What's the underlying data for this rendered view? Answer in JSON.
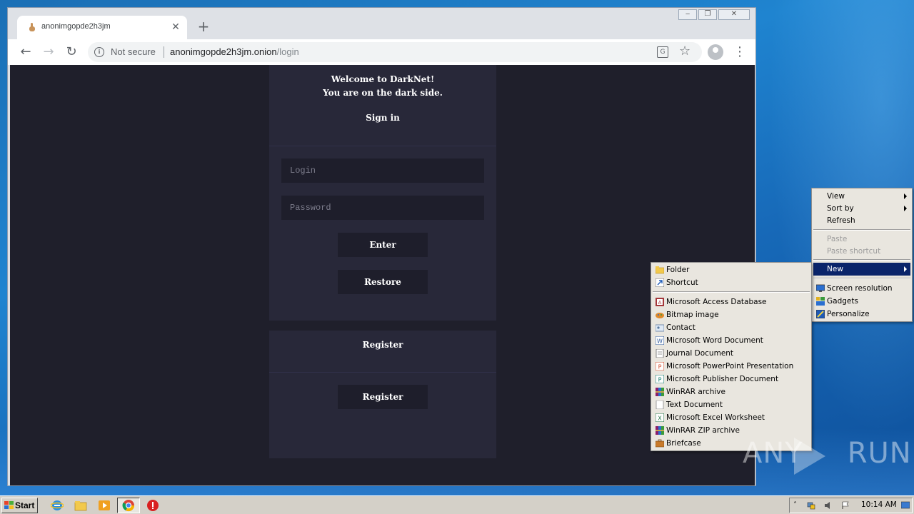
{
  "browser": {
    "tab_title": "anonimgopde2h3jm",
    "tab_close": "✕",
    "new_tab": "+",
    "security_label": "Not secure",
    "url_host": "anonimgopde2h3jm.onion",
    "url_path": "/login",
    "window_buttons": {
      "minimize": "‒",
      "maximize": "❐",
      "close": "✕"
    }
  },
  "page": {
    "welcome_line1": "Welcome to DarkNet!",
    "welcome_line2": "You are on the dark side.",
    "signin_heading": "Sign in",
    "login_placeholder": "Login",
    "password_placeholder": "Password",
    "enter_button": "Enter",
    "restore_button": "Restore",
    "register_heading": "Register",
    "register_button": "Register"
  },
  "context_menu": {
    "items": [
      "View",
      "Sort by",
      "Refresh",
      "Paste",
      "Paste shortcut",
      "New",
      "Screen resolution",
      "Gadgets",
      "Personalize"
    ]
  },
  "new_submenu": {
    "items": [
      "Folder",
      "Shortcut",
      "Microsoft Access Database",
      "Bitmap image",
      "Contact",
      "Microsoft Word Document",
      "Journal Document",
      "Microsoft PowerPoint Presentation",
      "Microsoft Publisher Document",
      "WinRAR archive",
      "Text Document",
      "Microsoft Excel Worksheet",
      "WinRAR ZIP archive",
      "Briefcase"
    ]
  },
  "taskbar": {
    "start_label": "Start",
    "clock": "10:14 AM"
  },
  "watermark": {
    "left": "ANY",
    "right": "RUN"
  },
  "colors": {
    "page_bg": "#1f1f2b",
    "panel_bg": "#282839",
    "menu_highlight": "#0a246a"
  }
}
